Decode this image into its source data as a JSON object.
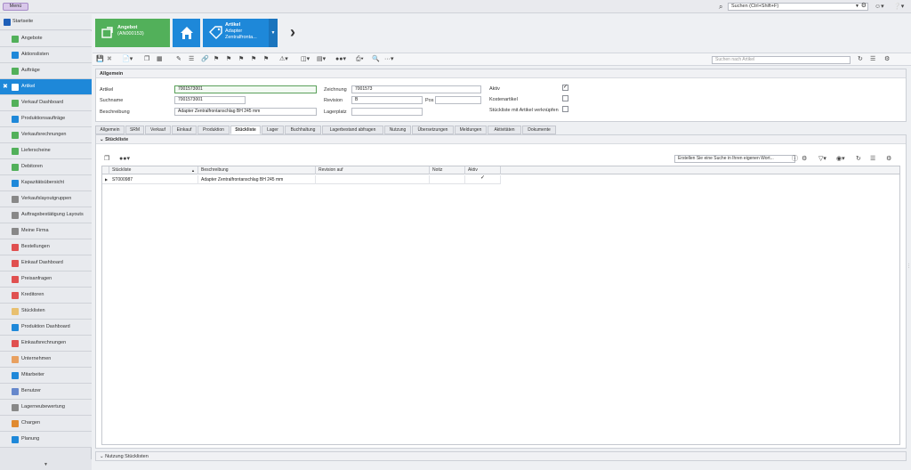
{
  "topbar": {
    "menu_label": "Menü",
    "search_value": "Suchen (Ctrl+Shift+F)"
  },
  "sidebar": {
    "home_label": "Startseite",
    "items": [
      {
        "label": "Angebote",
        "color": "#52b05a"
      },
      {
        "label": "Aktionslisten",
        "color": "#1e88d9"
      },
      {
        "label": "Aufträge",
        "color": "#52b05a"
      },
      {
        "label": "Artikel",
        "color": "#ffffff"
      },
      {
        "label": "Verkauf Dashboard",
        "color": "#52b05a"
      },
      {
        "label": "Produktionsaufträge",
        "color": "#1e88d9"
      },
      {
        "label": "Verkaufsrechnungen",
        "color": "#52b05a"
      },
      {
        "label": "Lieferscheine",
        "color": "#52b05a"
      },
      {
        "label": "Debitoren",
        "color": "#52b05a"
      },
      {
        "label": "Kapazitätsübersicht",
        "color": "#1e88d9"
      },
      {
        "label": "Verkaufslayoutgruppen",
        "color": "#888888"
      },
      {
        "label": "Auftragsbestätigung Layouts",
        "color": "#888888"
      },
      {
        "label": "Meine Firma",
        "color": "#888888"
      },
      {
        "label": "Bestellungen",
        "color": "#e05050"
      },
      {
        "label": "Einkauf Dashboard",
        "color": "#e05050"
      },
      {
        "label": "Preisanfragen",
        "color": "#e05050"
      },
      {
        "label": "Kreditoren",
        "color": "#e05050"
      },
      {
        "label": "Stücklisten",
        "color": "#e8c070"
      },
      {
        "label": "Produktion Dashboard",
        "color": "#1e88d9"
      },
      {
        "label": "Einkaufsrechnungen",
        "color": "#e05050"
      },
      {
        "label": "Unternehmen",
        "color": "#e8a060"
      },
      {
        "label": "Mitarbeiter",
        "color": "#1e88d9"
      },
      {
        "label": "Benutzer",
        "color": "#6688cc"
      },
      {
        "label": "Lagerneubewertung",
        "color": "#888888"
      },
      {
        "label": "Chargen",
        "color": "#e08a30"
      },
      {
        "label": "Planung",
        "color": "#1e88d9"
      }
    ]
  },
  "tiles": {
    "angebot_title": "Angebot",
    "angebot_sub": "(AN000153)",
    "artikel_title": "Artikel",
    "artikel_sub1": "Adapter",
    "artikel_sub2": "Zentralfronta..."
  },
  "toolbar": {
    "search_placeholder": "Suchen nach Artikel"
  },
  "allgemein": {
    "title": "Allgemein",
    "artikel_label": "Artikel",
    "artikel_value": "7001573001",
    "suchname_label": "Suchname",
    "suchname_value": "7001573001",
    "beschreibung_label": "Beschreibung",
    "beschreibung_value": "Adapter Zentralfrontanschlag BH 245 mm",
    "zeichnung_label": "Zeichnung",
    "zeichnung_value": "7001573",
    "revision_label": "Revision",
    "revision_value": "B",
    "pos_label": "Pos",
    "pos_value": "",
    "lagerplatz_label": "Lagerplatz",
    "lagerplatz_value": "",
    "aktiv_label": "Aktiv",
    "kostenartikel_label": "Kostenartikel",
    "verknuepfen_label": "Stückliste mit Artikel verknüpfen"
  },
  "tabs": [
    {
      "label": "Allgemein"
    },
    {
      "label": "SRM"
    },
    {
      "label": "Verkauf"
    },
    {
      "label": "Einkauf"
    },
    {
      "label": "Produktion"
    },
    {
      "label": "Stückliste"
    },
    {
      "label": "Lager"
    },
    {
      "label": "Buchhaltung"
    },
    {
      "label": "Lagerbestand abfragen"
    },
    {
      "label": "Nutzung"
    },
    {
      "label": "Übersetzungen"
    },
    {
      "label": "Meldungen"
    },
    {
      "label": "Aktivitäten"
    },
    {
      "label": "Dokumente"
    }
  ],
  "stueckliste": {
    "title": "Stückliste",
    "search_value": "Erstellen Sie eine Suche in Ihren eigenen Wort...",
    "columns": [
      "Stückliste",
      "Beschreibung",
      "Revision auf",
      "Notiz",
      "Aktiv"
    ],
    "rows": [
      {
        "stueckliste": "ST000987",
        "beschreibung": "Adapter Zentralfrontanschlag BH 245 mm",
        "revision": "",
        "notiz": ""
      }
    ]
  },
  "bottom": {
    "label": "Nutzung Stücklisten"
  }
}
